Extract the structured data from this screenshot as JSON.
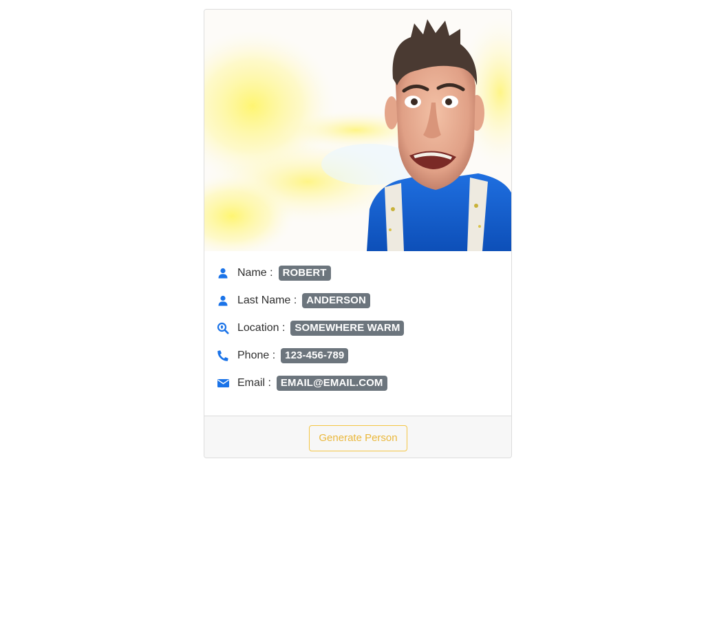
{
  "person": {
    "photo_alt": "",
    "fields": [
      {
        "icon": "user-icon",
        "label": "Name :",
        "value": "ROBERT"
      },
      {
        "icon": "user-icon",
        "label": "Last Name :",
        "value": "ANDERSON"
      },
      {
        "icon": "search-location-icon",
        "label": "Location :",
        "value": "SOMEWHERE WARM"
      },
      {
        "icon": "phone-icon",
        "label": "Phone :",
        "value": "123-456-789"
      },
      {
        "icon": "envelope-icon",
        "label": "Email :",
        "value": "EMAIL@EMAIL.COM"
      }
    ]
  },
  "footer": {
    "generate_label": "Generate Person"
  },
  "colors": {
    "icon": "#1a73e8",
    "badge": "#6c757d",
    "button_outline": "#f4c542",
    "button_text": "#eab73a"
  }
}
